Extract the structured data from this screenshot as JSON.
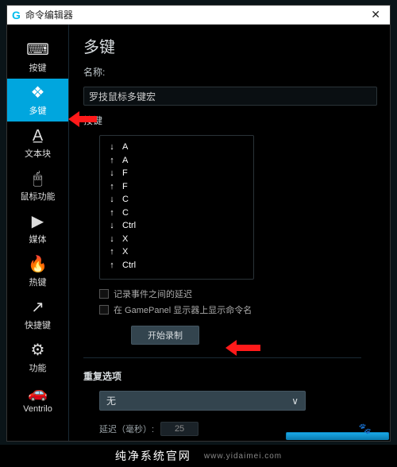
{
  "titlebar": {
    "title": "命令编辑器"
  },
  "sidebar": {
    "items": [
      {
        "icon": "⌨",
        "label": "按键"
      },
      {
        "icon": "❖",
        "label": "多键"
      },
      {
        "icon": "A̲",
        "label": "文本块"
      },
      {
        "icon": "🖱",
        "label": "鼠标功能"
      },
      {
        "icon": "▶",
        "label": "媒体"
      },
      {
        "icon": "🔥",
        "label": "热键"
      },
      {
        "icon": "↗",
        "label": "快捷键"
      },
      {
        "icon": "⚙",
        "label": "功能"
      },
      {
        "icon": "🚗",
        "label": "Ventrilo"
      }
    ]
  },
  "content": {
    "heading": "多键",
    "name_label": "名称:",
    "name_value": "罗技鼠标多键宏",
    "keys_label": "按键",
    "keys": [
      {
        "dir": "down",
        "key": "A"
      },
      {
        "dir": "up",
        "key": "A"
      },
      {
        "dir": "down",
        "key": "F"
      },
      {
        "dir": "up",
        "key": "F"
      },
      {
        "dir": "down",
        "key": "C"
      },
      {
        "dir": "up",
        "key": "C"
      },
      {
        "dir": "down",
        "key": "Ctrl"
      },
      {
        "dir": "down",
        "key": "X"
      },
      {
        "dir": "up",
        "key": "X"
      },
      {
        "dir": "up",
        "key": "Ctrl"
      }
    ],
    "opt_record_delays": "记录事件之间的延迟",
    "opt_show_gamepanel": "在 GamePanel 显示器上显示命令名",
    "start_record": "开始录制",
    "repeat_title": "重复选项",
    "repeat_value": "无",
    "delay_label": "延迟（毫秒）:",
    "delay_value": "25"
  },
  "footer": {
    "brand": "纯净系统官网",
    "site": "www.yidaimei.com"
  }
}
